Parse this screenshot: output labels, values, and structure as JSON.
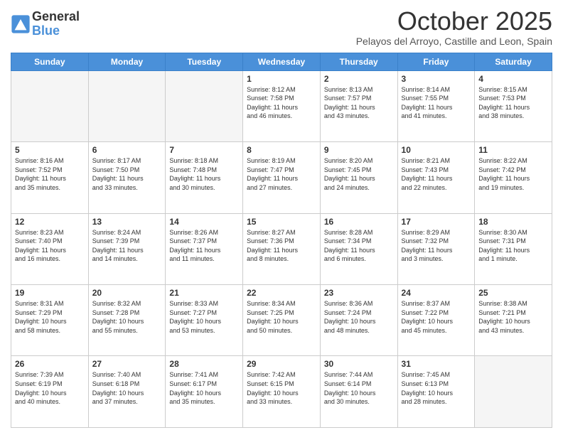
{
  "logo": {
    "general": "General",
    "blue": "Blue"
  },
  "header": {
    "month": "October 2025",
    "location": "Pelayos del Arroyo, Castille and Leon, Spain"
  },
  "weekdays": [
    "Sunday",
    "Monday",
    "Tuesday",
    "Wednesday",
    "Thursday",
    "Friday",
    "Saturday"
  ],
  "weeks": [
    [
      {
        "day": "",
        "info": ""
      },
      {
        "day": "",
        "info": ""
      },
      {
        "day": "",
        "info": ""
      },
      {
        "day": "1",
        "info": "Sunrise: 8:12 AM\nSunset: 7:58 PM\nDaylight: 11 hours\nand 46 minutes."
      },
      {
        "day": "2",
        "info": "Sunrise: 8:13 AM\nSunset: 7:57 PM\nDaylight: 11 hours\nand 43 minutes."
      },
      {
        "day": "3",
        "info": "Sunrise: 8:14 AM\nSunset: 7:55 PM\nDaylight: 11 hours\nand 41 minutes."
      },
      {
        "day": "4",
        "info": "Sunrise: 8:15 AM\nSunset: 7:53 PM\nDaylight: 11 hours\nand 38 minutes."
      }
    ],
    [
      {
        "day": "5",
        "info": "Sunrise: 8:16 AM\nSunset: 7:52 PM\nDaylight: 11 hours\nand 35 minutes."
      },
      {
        "day": "6",
        "info": "Sunrise: 8:17 AM\nSunset: 7:50 PM\nDaylight: 11 hours\nand 33 minutes."
      },
      {
        "day": "7",
        "info": "Sunrise: 8:18 AM\nSunset: 7:48 PM\nDaylight: 11 hours\nand 30 minutes."
      },
      {
        "day": "8",
        "info": "Sunrise: 8:19 AM\nSunset: 7:47 PM\nDaylight: 11 hours\nand 27 minutes."
      },
      {
        "day": "9",
        "info": "Sunrise: 8:20 AM\nSunset: 7:45 PM\nDaylight: 11 hours\nand 24 minutes."
      },
      {
        "day": "10",
        "info": "Sunrise: 8:21 AM\nSunset: 7:43 PM\nDaylight: 11 hours\nand 22 minutes."
      },
      {
        "day": "11",
        "info": "Sunrise: 8:22 AM\nSunset: 7:42 PM\nDaylight: 11 hours\nand 19 minutes."
      }
    ],
    [
      {
        "day": "12",
        "info": "Sunrise: 8:23 AM\nSunset: 7:40 PM\nDaylight: 11 hours\nand 16 minutes."
      },
      {
        "day": "13",
        "info": "Sunrise: 8:24 AM\nSunset: 7:39 PM\nDaylight: 11 hours\nand 14 minutes."
      },
      {
        "day": "14",
        "info": "Sunrise: 8:26 AM\nSunset: 7:37 PM\nDaylight: 11 hours\nand 11 minutes."
      },
      {
        "day": "15",
        "info": "Sunrise: 8:27 AM\nSunset: 7:36 PM\nDaylight: 11 hours\nand 8 minutes."
      },
      {
        "day": "16",
        "info": "Sunrise: 8:28 AM\nSunset: 7:34 PM\nDaylight: 11 hours\nand 6 minutes."
      },
      {
        "day": "17",
        "info": "Sunrise: 8:29 AM\nSunset: 7:32 PM\nDaylight: 11 hours\nand 3 minutes."
      },
      {
        "day": "18",
        "info": "Sunrise: 8:30 AM\nSunset: 7:31 PM\nDaylight: 11 hours\nand 1 minute."
      }
    ],
    [
      {
        "day": "19",
        "info": "Sunrise: 8:31 AM\nSunset: 7:29 PM\nDaylight: 10 hours\nand 58 minutes."
      },
      {
        "day": "20",
        "info": "Sunrise: 8:32 AM\nSunset: 7:28 PM\nDaylight: 10 hours\nand 55 minutes."
      },
      {
        "day": "21",
        "info": "Sunrise: 8:33 AM\nSunset: 7:27 PM\nDaylight: 10 hours\nand 53 minutes."
      },
      {
        "day": "22",
        "info": "Sunrise: 8:34 AM\nSunset: 7:25 PM\nDaylight: 10 hours\nand 50 minutes."
      },
      {
        "day": "23",
        "info": "Sunrise: 8:36 AM\nSunset: 7:24 PM\nDaylight: 10 hours\nand 48 minutes."
      },
      {
        "day": "24",
        "info": "Sunrise: 8:37 AM\nSunset: 7:22 PM\nDaylight: 10 hours\nand 45 minutes."
      },
      {
        "day": "25",
        "info": "Sunrise: 8:38 AM\nSunset: 7:21 PM\nDaylight: 10 hours\nand 43 minutes."
      }
    ],
    [
      {
        "day": "26",
        "info": "Sunrise: 7:39 AM\nSunset: 6:19 PM\nDaylight: 10 hours\nand 40 minutes."
      },
      {
        "day": "27",
        "info": "Sunrise: 7:40 AM\nSunset: 6:18 PM\nDaylight: 10 hours\nand 37 minutes."
      },
      {
        "day": "28",
        "info": "Sunrise: 7:41 AM\nSunset: 6:17 PM\nDaylight: 10 hours\nand 35 minutes."
      },
      {
        "day": "29",
        "info": "Sunrise: 7:42 AM\nSunset: 6:15 PM\nDaylight: 10 hours\nand 33 minutes."
      },
      {
        "day": "30",
        "info": "Sunrise: 7:44 AM\nSunset: 6:14 PM\nDaylight: 10 hours\nand 30 minutes."
      },
      {
        "day": "31",
        "info": "Sunrise: 7:45 AM\nSunset: 6:13 PM\nDaylight: 10 hours\nand 28 minutes."
      },
      {
        "day": "",
        "info": ""
      }
    ]
  ]
}
